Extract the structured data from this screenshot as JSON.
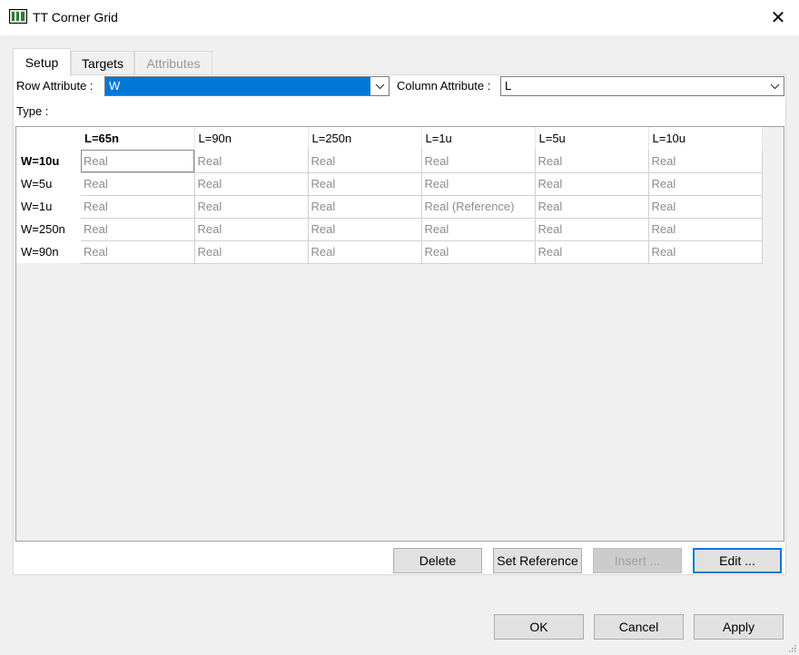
{
  "window": {
    "title": "TT Corner Grid",
    "close_icon": "close-icon",
    "app_icon": "grid-app-icon"
  },
  "tabs": [
    {
      "label": "Setup",
      "state": "active"
    },
    {
      "label": "Targets",
      "state": "normal"
    },
    {
      "label": "Attributes",
      "state": "disabled"
    }
  ],
  "setup": {
    "row_attribute_label": "Row Attribute :",
    "row_attribute_value": "W",
    "column_attribute_label": "Column Attribute :",
    "column_attribute_value": "L",
    "type_label": "Type :"
  },
  "grid": {
    "columns": [
      "L=65n",
      "L=90n",
      "L=250n",
      "L=1u",
      "L=5u",
      "L=10u"
    ],
    "rows": [
      {
        "header": "W=10u",
        "cells": [
          "Real",
          "Real",
          "Real",
          "Real",
          "Real",
          "Real"
        ]
      },
      {
        "header": "W=5u",
        "cells": [
          "Real",
          "Real",
          "Real",
          "Real",
          "Real",
          "Real"
        ]
      },
      {
        "header": "W=1u",
        "cells": [
          "Real",
          "Real",
          "Real",
          "Real (Reference)",
          "Real",
          "Real"
        ]
      },
      {
        "header": "W=250n",
        "cells": [
          "Real",
          "Real",
          "Real",
          "Real",
          "Real",
          "Real"
        ]
      },
      {
        "header": "W=90n",
        "cells": [
          "Real",
          "Real",
          "Real",
          "Real",
          "Real",
          "Real"
        ]
      }
    ]
  },
  "grid_buttons": {
    "delete": "Delete",
    "set_reference": "Set Reference",
    "insert": "Insert ...",
    "edit": "Edit ..."
  },
  "dialog_buttons": {
    "ok": "OK",
    "cancel": "Cancel",
    "apply": "Apply"
  },
  "colors": {
    "selection": "#0078d7",
    "disabled_text": "#a0a0a0"
  }
}
